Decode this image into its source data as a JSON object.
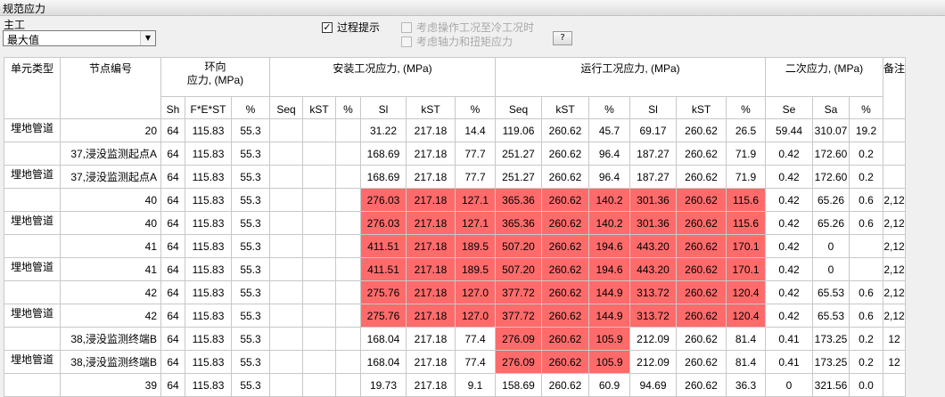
{
  "window_title": "规范应力",
  "combo": {
    "label": "主工",
    "value": "最大值"
  },
  "options": [
    {
      "label": "过程提示",
      "checked": true,
      "enabled": true
    },
    {
      "label": "考虑操作工况至冷工况时",
      "checked": false,
      "enabled": false
    },
    {
      "label": "考虑轴力和扭矩应力",
      "checked": false,
      "enabled": false
    }
  ],
  "help_button": "?",
  "headers": {
    "top": [
      "单元类型",
      "节点编号",
      "环向\n应力, (MPa)",
      "安装工况应力, (MPa)",
      "运行工况应力, (MPa)",
      "二次应力, (MPa)",
      "备注"
    ],
    "sub": [
      "Sh",
      "F*E*ST",
      "%",
      "Seq",
      "kST",
      "%",
      "Sl",
      "kST",
      "%",
      "Seq",
      "kST",
      "%",
      "Sl",
      "kST",
      "%",
      "Se",
      "Sa",
      "%"
    ]
  },
  "highlight_color": "#ff6b6b",
  "rows": [
    {
      "type": "埋地管道",
      "node": "20",
      "c": [
        "64",
        "115.83",
        "55.3",
        "",
        "",
        "",
        "31.22",
        "217.18",
        "14.4",
        "119.06",
        "260.62",
        "45.7",
        "69.17",
        "260.62",
        "26.5",
        "59.44",
        "310.07",
        "19.2",
        ""
      ],
      "hl": []
    },
    {
      "type": "",
      "node": "37,浸没监测起点A",
      "c": [
        "64",
        "115.83",
        "55.3",
        "",
        "",
        "",
        "168.69",
        "217.18",
        "77.7",
        "251.27",
        "260.62",
        "96.4",
        "187.27",
        "260.62",
        "71.9",
        "0.42",
        "172.60",
        "0.2",
        ""
      ],
      "hl": []
    },
    {
      "type": "埋地管道",
      "node": "37,浸没监测起点A",
      "c": [
        "64",
        "115.83",
        "55.3",
        "",
        "",
        "",
        "168.69",
        "217.18",
        "77.7",
        "251.27",
        "260.62",
        "96.4",
        "187.27",
        "260.62",
        "71.9",
        "0.42",
        "172.60",
        "0.2",
        ""
      ],
      "hl": []
    },
    {
      "type": "",
      "node": "40",
      "c": [
        "64",
        "115.83",
        "55.3",
        "",
        "",
        "",
        "276.03",
        "217.18",
        "127.1",
        "365.36",
        "260.62",
        "140.2",
        "301.36",
        "260.62",
        "115.6",
        "0.42",
        "65.26",
        "0.6",
        "2,12"
      ],
      "hl": [
        6,
        7,
        8,
        9,
        10,
        11,
        12,
        13,
        14
      ]
    },
    {
      "type": "埋地管道",
      "node": "40",
      "c": [
        "64",
        "115.83",
        "55.3",
        "",
        "",
        "",
        "276.03",
        "217.18",
        "127.1",
        "365.36",
        "260.62",
        "140.2",
        "301.36",
        "260.62",
        "115.6",
        "0.42",
        "65.26",
        "0.6",
        "2,12"
      ],
      "hl": [
        6,
        7,
        8,
        9,
        10,
        11,
        12,
        13,
        14
      ]
    },
    {
      "type": "",
      "node": "41",
      "c": [
        "64",
        "115.83",
        "55.3",
        "",
        "",
        "",
        "411.51",
        "217.18",
        "189.5",
        "507.20",
        "260.62",
        "194.6",
        "443.20",
        "260.62",
        "170.1",
        "0.42",
        "0",
        "",
        "2,12"
      ],
      "hl": [
        6,
        7,
        8,
        9,
        10,
        11,
        12,
        13,
        14
      ]
    },
    {
      "type": "埋地管道",
      "node": "41",
      "c": [
        "64",
        "115.83",
        "55.3",
        "",
        "",
        "",
        "411.51",
        "217.18",
        "189.5",
        "507.20",
        "260.62",
        "194.6",
        "443.20",
        "260.62",
        "170.1",
        "0.42",
        "0",
        "",
        "2,12"
      ],
      "hl": [
        6,
        7,
        8,
        9,
        10,
        11,
        12,
        13,
        14
      ]
    },
    {
      "type": "",
      "node": "42",
      "c": [
        "64",
        "115.83",
        "55.3",
        "",
        "",
        "",
        "275.76",
        "217.18",
        "127.0",
        "377.72",
        "260.62",
        "144.9",
        "313.72",
        "260.62",
        "120.4",
        "0.42",
        "65.53",
        "0.6",
        "2,12"
      ],
      "hl": [
        6,
        7,
        8,
        9,
        10,
        11,
        12,
        13,
        14
      ]
    },
    {
      "type": "埋地管道",
      "node": "42",
      "c": [
        "64",
        "115.83",
        "55.3",
        "",
        "",
        "",
        "275.76",
        "217.18",
        "127.0",
        "377.72",
        "260.62",
        "144.9",
        "313.72",
        "260.62",
        "120.4",
        "0.42",
        "65.53",
        "0.6",
        "2,12"
      ],
      "hl": [
        6,
        7,
        8,
        9,
        10,
        11,
        12,
        13,
        14
      ]
    },
    {
      "type": "",
      "node": "38,浸没监测终端B",
      "c": [
        "64",
        "115.83",
        "55.3",
        "",
        "",
        "",
        "168.04",
        "217.18",
        "77.4",
        "276.09",
        "260.62",
        "105.9",
        "212.09",
        "260.62",
        "81.4",
        "0.41",
        "173.25",
        "0.2",
        "12"
      ],
      "hl": [
        9,
        10,
        11
      ]
    },
    {
      "type": "埋地管道",
      "node": "38,浸没监测终端B",
      "c": [
        "64",
        "115.83",
        "55.3",
        "",
        "",
        "",
        "168.04",
        "217.18",
        "77.4",
        "276.09",
        "260.62",
        "105.9",
        "212.09",
        "260.62",
        "81.4",
        "0.41",
        "173.25",
        "0.2",
        "12"
      ],
      "hl": [
        9,
        10,
        11
      ]
    },
    {
      "type": "",
      "node": "39",
      "c": [
        "64",
        "115.83",
        "55.3",
        "",
        "",
        "",
        "19.73",
        "217.18",
        "9.1",
        "158.69",
        "260.62",
        "60.9",
        "94.69",
        "260.62",
        "36.3",
        "0",
        "321.56",
        "0.0",
        ""
      ],
      "hl": []
    }
  ]
}
